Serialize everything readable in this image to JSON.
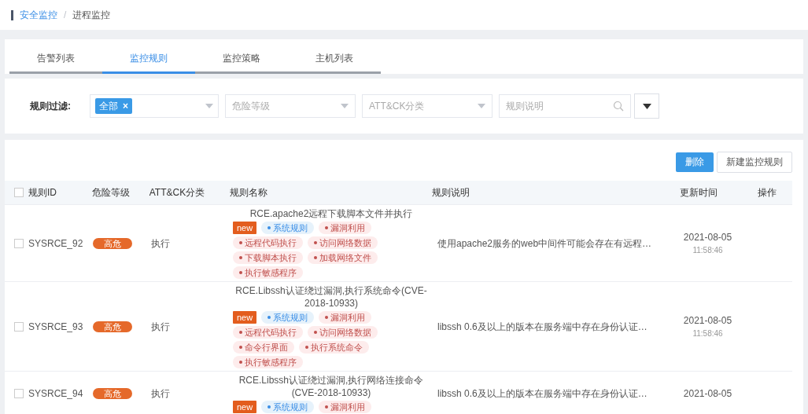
{
  "breadcrumb": [
    "安全监控",
    "进程监控"
  ],
  "breadcrumb_separator": "/",
  "tabs": [
    {
      "label": "告警列表",
      "selected": false
    },
    {
      "label": "监控规则",
      "selected": true
    },
    {
      "label": "监控策略",
      "selected": false
    },
    {
      "label": "主机列表",
      "selected": false
    }
  ],
  "filter": {
    "label": "规则过滤:",
    "chip": "全部",
    "chip_remove": "×",
    "level_placeholder": "危险等级",
    "attck_placeholder": "ATT&CK分类",
    "search_placeholder": "规则说明"
  },
  "actions": [
    "删除",
    "新建监控规则"
  ],
  "table": {
    "all_checked": false,
    "columns": [
      "规则ID",
      "危险等级",
      "ATT&CK分类",
      "规则名称",
      "规则说明",
      "更新时间",
      "操作"
    ],
    "rows": [
      {
        "checked": false,
        "id": "SYSRCE_92",
        "level": "高危",
        "attck": "执行",
        "name": "RCE.apache2远程下载脚本文件并执行",
        "tags": [
          {
            "kind": "new",
            "text": "new"
          },
          {
            "kind": "system",
            "text": "系统规则"
          },
          {
            "kind": "attack",
            "text": "漏洞利用"
          },
          {
            "kind": "attack",
            "text": "远程代码执行"
          },
          {
            "kind": "attack",
            "text": "访问网络数据"
          },
          {
            "kind": "attack",
            "text": "下载脚本执行"
          },
          {
            "kind": "attack",
            "text": "加载网络文件"
          },
          {
            "kind": "attack",
            "text": "执行敏感程序"
          }
        ],
        "description": "使用apache2服务的web中间件可能会存在有远程…",
        "date": "2021-08-05",
        "time": "11:58:46"
      },
      {
        "checked": false,
        "id": "SYSRCE_93",
        "level": "高危",
        "attck": "执行",
        "name": "RCE.Libssh认证绕过漏洞,执行系统命令(CVE-2018-10933)",
        "tags": [
          {
            "kind": "new",
            "text": "new"
          },
          {
            "kind": "system",
            "text": "系统规则"
          },
          {
            "kind": "attack",
            "text": "漏洞利用"
          },
          {
            "kind": "attack",
            "text": "远程代码执行"
          },
          {
            "kind": "attack",
            "text": "访问网络数据"
          },
          {
            "kind": "attack",
            "text": "命令行界面"
          },
          {
            "kind": "attack",
            "text": "执行系统命令"
          },
          {
            "kind": "attack",
            "text": "执行敏感程序"
          }
        ],
        "description": "libssh 0.6及以上的版本在服务端中存在身份认证…",
        "date": "2021-08-05",
        "time": "11:58:46"
      },
      {
        "checked": false,
        "id": "SYSRCE_94",
        "level": "高危",
        "attck": "执行",
        "name": "RCE.Libssh认证绕过漏洞,执行网络连接命令(CVE-2018-10933)",
        "tags": [
          {
            "kind": "new",
            "text": "new"
          },
          {
            "kind": "system",
            "text": "系统规则"
          },
          {
            "kind": "attack",
            "text": "漏洞利用"
          }
        ],
        "description": "libssh 0.6及以上的版本在服务端中存在身份认证…",
        "date": "2021-08-05"
      }
    ]
  }
}
